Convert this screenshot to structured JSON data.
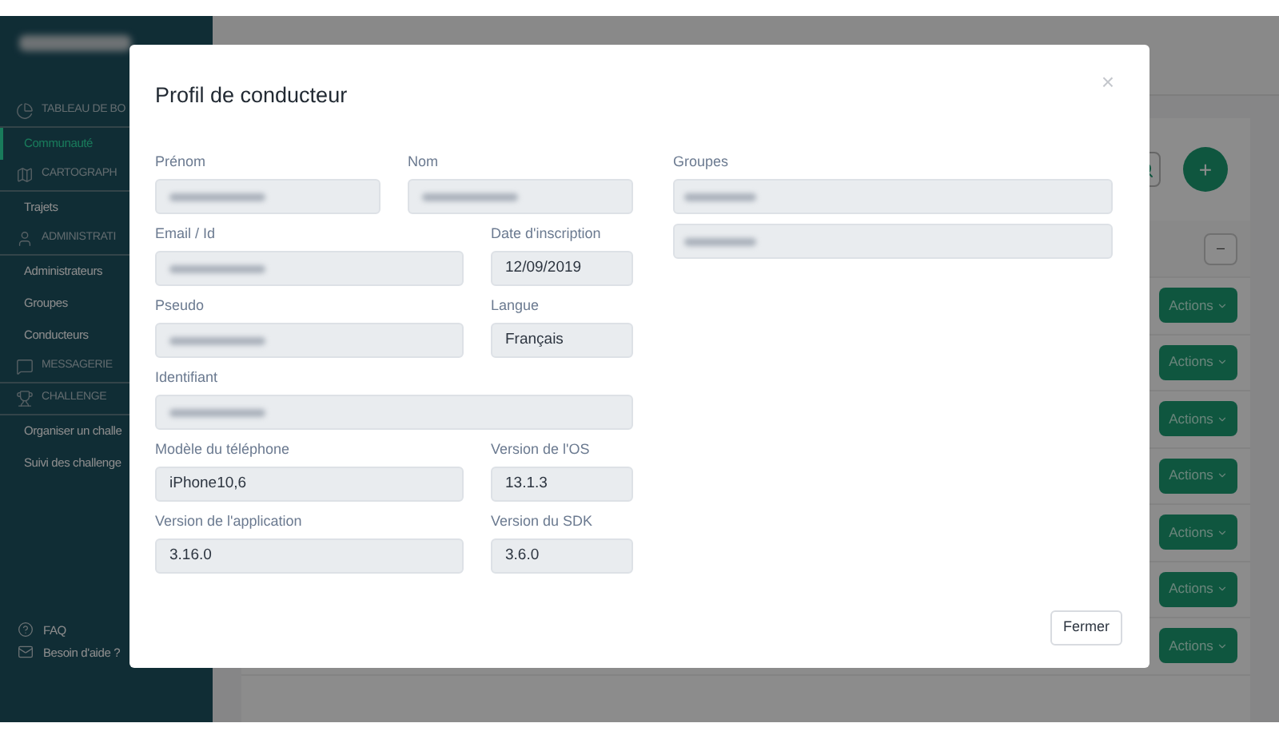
{
  "sidebar": {
    "logo": {
      "blurred": true
    },
    "sections": [
      {
        "kind": "dashboard",
        "label": "TABLEAU DE BO",
        "items": [
          {
            "label": "Communauté",
            "selected": true
          }
        ]
      },
      {
        "kind": "map",
        "label": "CARTOGRAPH",
        "items": [
          {
            "label": "Trajets",
            "selected": false
          }
        ]
      },
      {
        "kind": "admin",
        "label": "ADMINISTRATI",
        "items": [
          {
            "label": "Administrateurs",
            "selected": false
          },
          {
            "label": "Groupes",
            "selected": false
          },
          {
            "label": "Conducteurs",
            "selected": false
          }
        ]
      },
      {
        "kind": "messages",
        "label": "MESSAGERIE"
      },
      {
        "kind": "challenge",
        "label": "CHALLENGE",
        "items": [
          {
            "label": "Organiser un challe",
            "selected": false
          },
          {
            "label": "Suivi des challenge",
            "selected": false
          }
        ]
      }
    ],
    "footer": [
      {
        "kind": "help",
        "label": "FAQ"
      },
      {
        "kind": "mail",
        "label": "Besoin d'aide ?"
      }
    ]
  },
  "table": {
    "collapse_button": "–",
    "add_button": "+",
    "row_actions": [
      "Actions",
      "Actions",
      "Actions",
      "Actions",
      "Actions",
      "Actions",
      "Actions"
    ]
  },
  "modal": {
    "title": "Profil de conducteur",
    "close": "×",
    "rows": [
      [
        {
          "label": "Prénom",
          "blurred": true
        },
        {
          "label": "Nom",
          "blurred": true
        }
      ],
      [
        {
          "label": "Email / Id",
          "blurred": true
        },
        {
          "label": "Date d'inscription",
          "value": "12/09/2019",
          "blurred": false
        }
      ],
      [
        {
          "label": "Pseudo",
          "blurred": true
        },
        {
          "label": "Langue",
          "value": "Français",
          "blurred": false
        }
      ],
      [
        {
          "label": "Identifiant",
          "blurred": true
        }
      ],
      [
        {
          "label": "Modèle du téléphone",
          "value": "iPhone10,6",
          "blurred": false
        },
        {
          "label": "Version de l'OS",
          "value": "13.1.3",
          "blurred": false
        }
      ],
      [
        {
          "label": "Version de l'application",
          "value": "3.16.0",
          "blurred": false
        },
        {
          "label": "Version du SDK",
          "value": "3.6.0",
          "blurred": false
        }
      ]
    ],
    "groups": {
      "label": "Groupes",
      "entries": [
        {
          "blurred": true
        },
        {
          "blurred": true
        }
      ]
    },
    "close_button": "Fermer"
  }
}
